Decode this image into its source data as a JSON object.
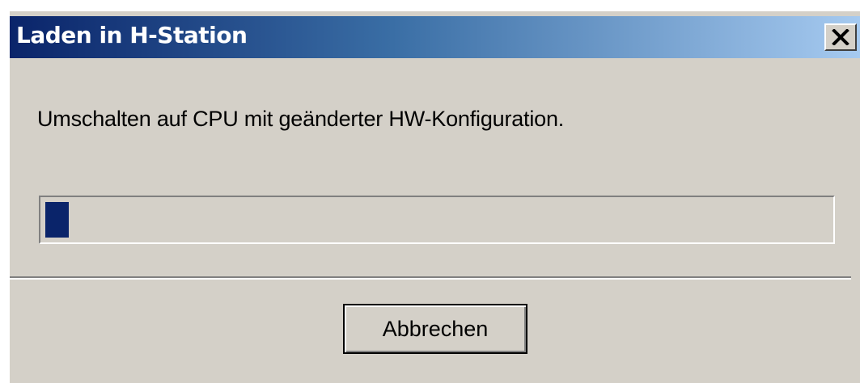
{
  "window": {
    "title": "Laden in H-Station",
    "close_icon": "close-icon"
  },
  "main": {
    "message": "Umschalten auf CPU mit geänderter HW-Konfiguration.",
    "progress_fraction": 0.03
  },
  "footer": {
    "cancel_label": "Abbrechen"
  },
  "colors": {
    "title_start": "#0a246a",
    "title_end": "#a6caf0",
    "face": "#d4d0c8",
    "progress_fill": "#0a246a"
  }
}
